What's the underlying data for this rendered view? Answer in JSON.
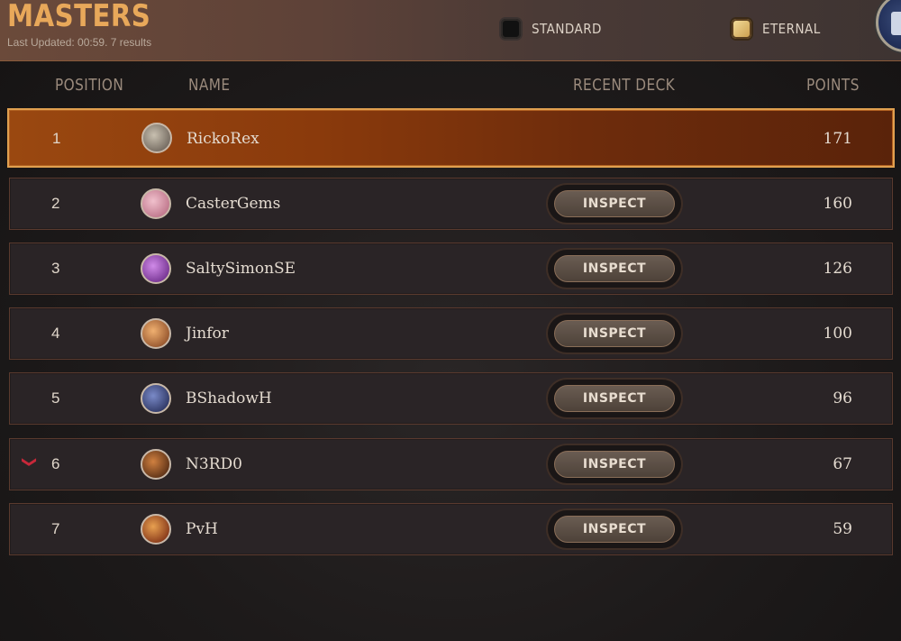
{
  "header": {
    "title": "MASTERS",
    "subtitle": "Last Updated: 00:59. 7 results",
    "toggles": [
      {
        "label": "STANDARD",
        "checked": false
      },
      {
        "label": "ETERNAL",
        "checked": true
      }
    ]
  },
  "columns": {
    "position": "POSITION",
    "name": "NAME",
    "recent_deck": "RECENT DECK",
    "points": "POINTS"
  },
  "rows": [
    {
      "position": "1",
      "name": "RickoRex",
      "points": "171",
      "inspect": "",
      "avatar_color": "#8a8070"
    },
    {
      "position": "2",
      "name": "CasterGems",
      "points": "160",
      "inspect": "INSPECT",
      "avatar_color": "#d88aa0"
    },
    {
      "position": "3",
      "name": "SaltySimonSE",
      "points": "126",
      "inspect": "INSPECT",
      "avatar_color": "#8a3aa8"
    },
    {
      "position": "4",
      "name": "Jinfor",
      "points": "100",
      "inspect": "INSPECT",
      "avatar_color": "#c8703a"
    },
    {
      "position": "5",
      "name": "BShadowH",
      "points": "96",
      "inspect": "INSPECT",
      "avatar_color": "#2a3a6a"
    },
    {
      "position": "6",
      "name": "N3RD0",
      "points": "67",
      "inspect": "INSPECT",
      "avatar_color": "#9a4a1a",
      "trend": "down"
    },
    {
      "position": "7",
      "name": "PvH",
      "points": "59",
      "inspect": "INSPECT",
      "avatar_color": "#8a2a1a"
    }
  ],
  "icons": {
    "trend_down": "chevron-down-icon"
  }
}
